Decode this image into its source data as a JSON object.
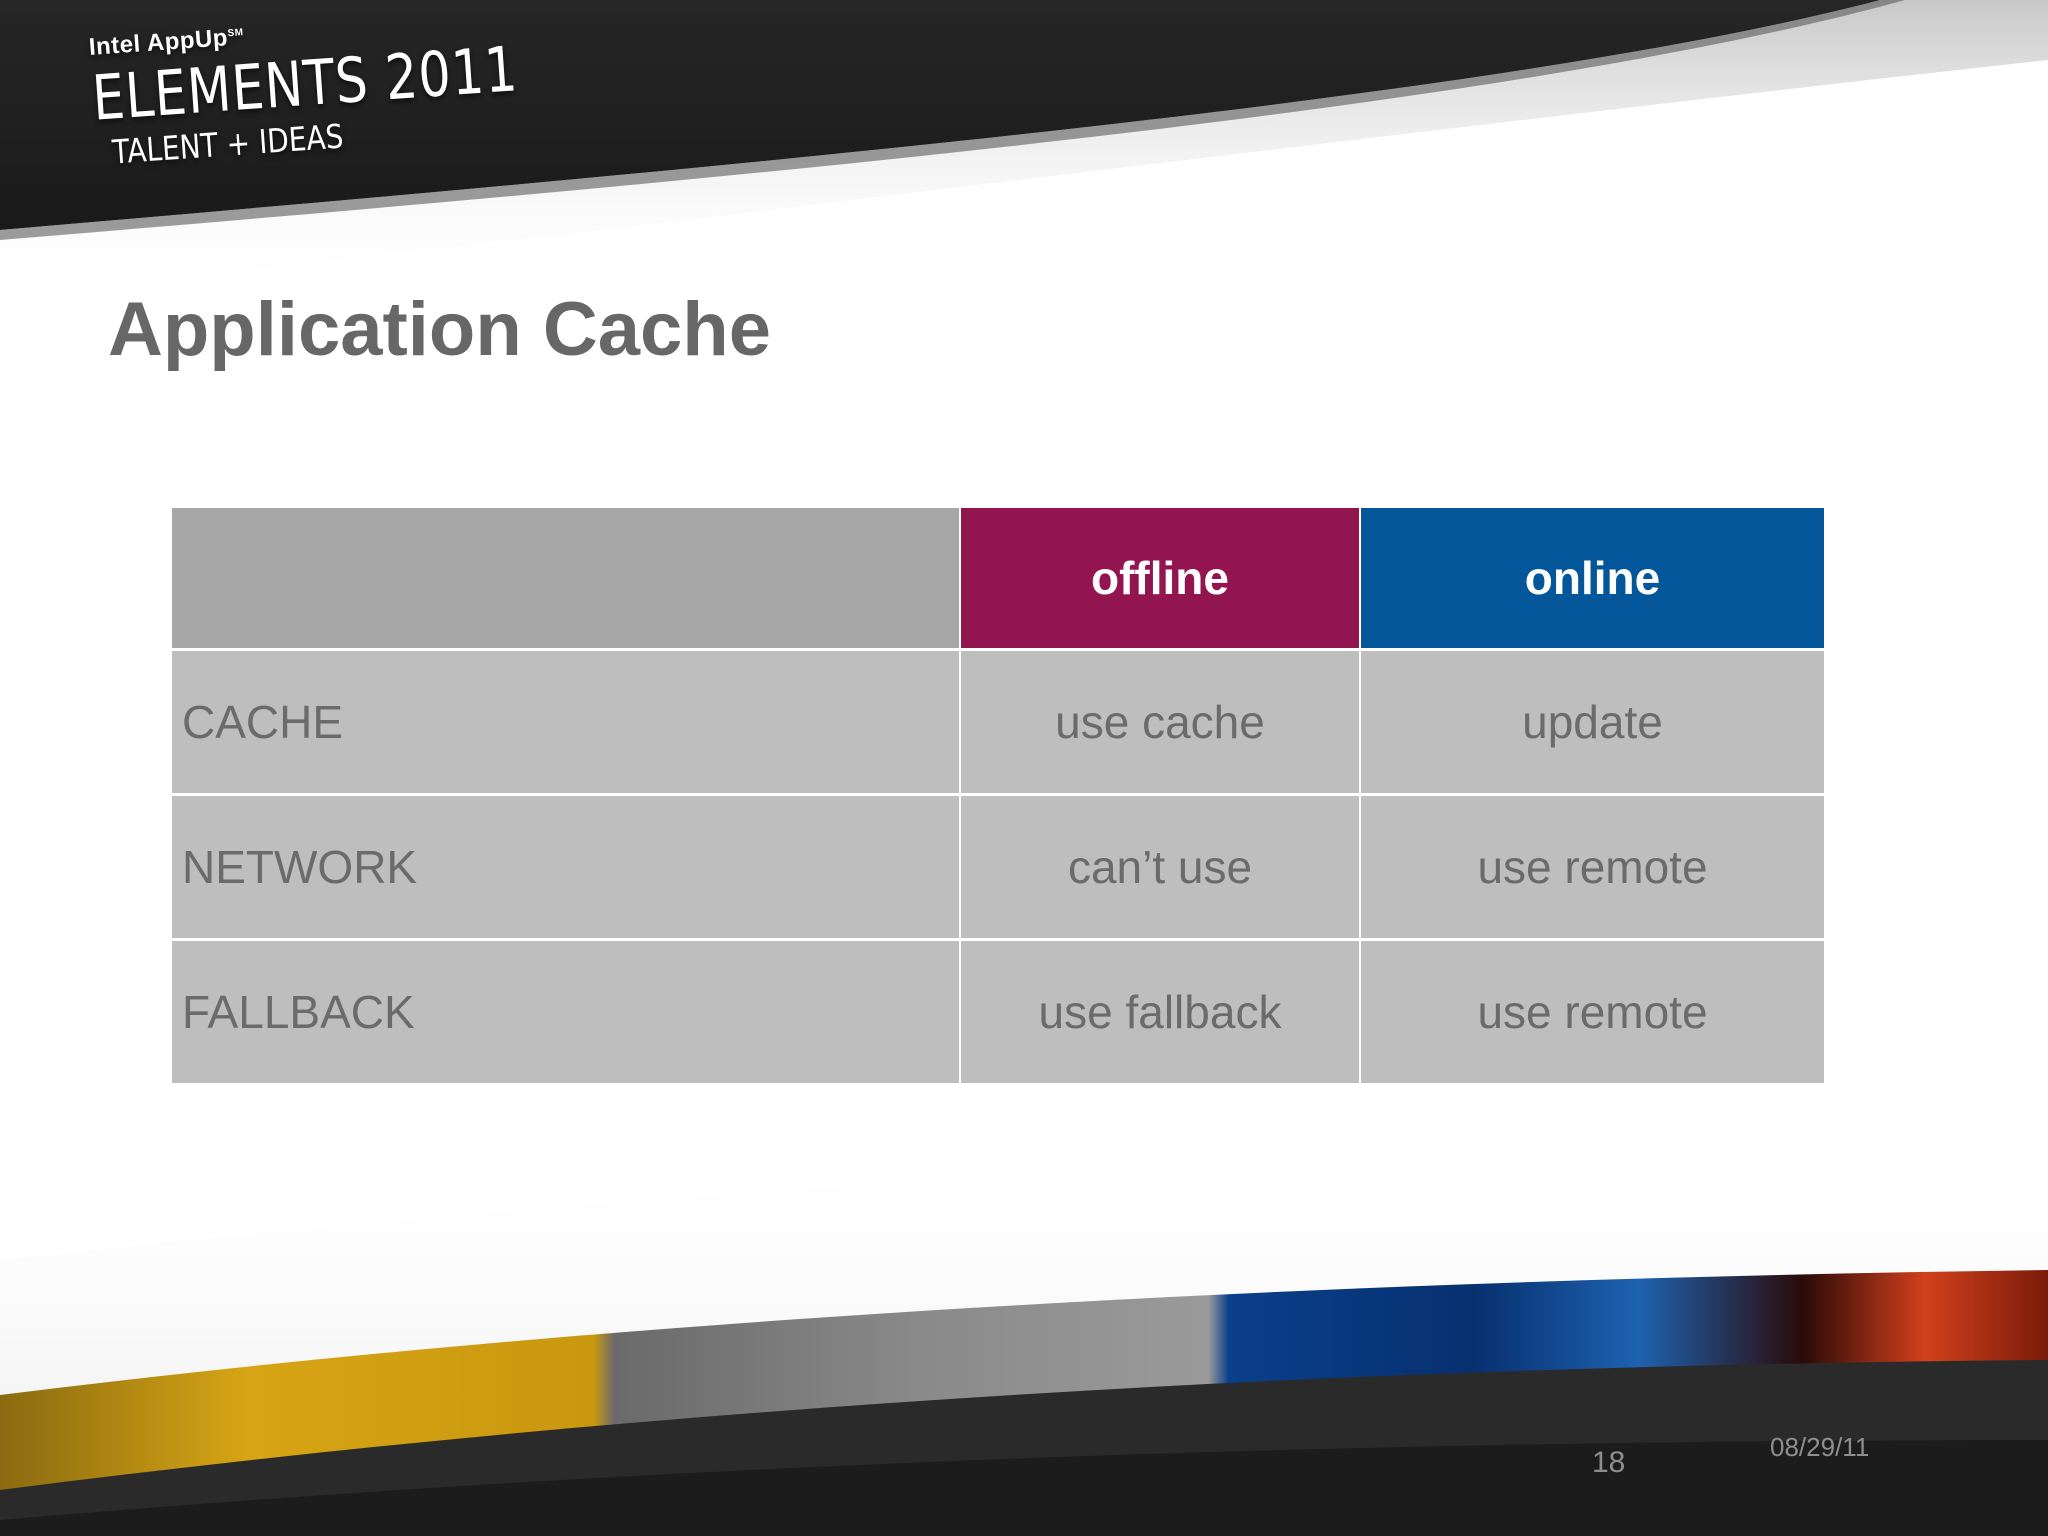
{
  "logo": {
    "brand": "Intel AppUp",
    "brand_mark": "SM",
    "event": "ELEMENTS 2011",
    "tagline": "TALENT + IDEAS"
  },
  "title": "Application Cache",
  "table": {
    "columns": [
      "",
      "offline",
      "online"
    ],
    "rows": [
      {
        "section": "CACHE",
        "offline": "use cache",
        "online": "update"
      },
      {
        "section": "NETWORK",
        "offline": "can’t use",
        "online": "use remote"
      },
      {
        "section": "FALLBACK",
        "offline": "use fallback",
        "online": "use remote"
      }
    ]
  },
  "footer": {
    "slide_number": "18",
    "date": "08/29/11"
  },
  "colors": {
    "offline_header": "#93154f",
    "online_header": "#04569a",
    "title_text": "#676767",
    "cell_bg": "#bebebf",
    "header_blank_bg": "#a7a7a7",
    "banner_dark": "#1f1f1f"
  }
}
